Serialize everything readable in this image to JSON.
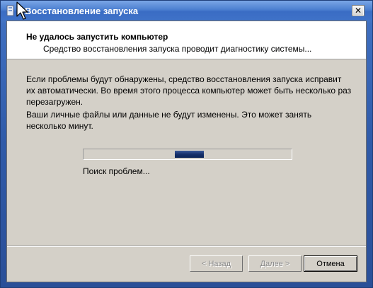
{
  "window": {
    "title": "Восстановление запуска",
    "close_glyph": "✕",
    "title_icon": "startup-repair-icon"
  },
  "header": {
    "title": "Не удалось запустить компьютер",
    "subtitle": "Средство восстановления запуска проводит диагностику системы..."
  },
  "body": {
    "paragraph1": "Если проблемы будут обнаружены, средство восстановления запуска исправит их автоматически. Во время этого процесса компьютер может быть несколько раз перезагружен.",
    "paragraph2": "Ваши личные файлы или данные не будут изменены. Это может занять несколько минут.",
    "progress": {
      "style": "marquee",
      "indicator_position_fraction": 0.44,
      "indicator_width_fraction": 0.14,
      "status": "Поиск проблем..."
    }
  },
  "footer": {
    "back_label": "< Назад",
    "next_label": "Далее >",
    "cancel_label": "Отмена",
    "back_enabled": false,
    "next_enabled": false
  },
  "colors": {
    "titlebar": "#4c7fd0",
    "client_background": "#d4d0c8",
    "progress_fill": "#16306b"
  }
}
